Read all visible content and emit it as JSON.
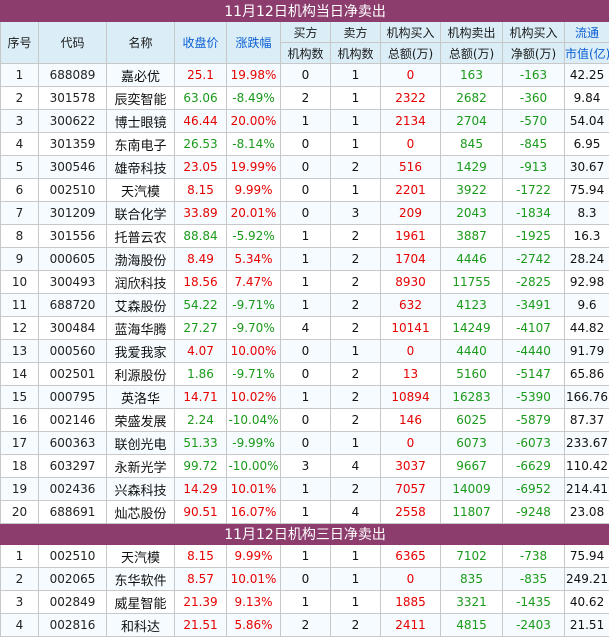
{
  "table1": {
    "title": "11月12日机构当日净卖出",
    "headers": {
      "idx": "序号",
      "code": "代码",
      "name": "名称",
      "close": "收盘价",
      "change": "涨跌幅",
      "buy_a": "买方",
      "buy_b": "机构数",
      "sell_a": "卖方",
      "sell_b": "机构数",
      "inst_buy_a": "机构买入",
      "inst_buy_b": "总额(万)",
      "inst_sell_a": "机构卖出",
      "inst_sell_b": "总额(万)",
      "net_a": "机构买入",
      "net_b": "净额(万)",
      "cap_a": "流通",
      "cap_b": "市值(亿)"
    },
    "rows": [
      {
        "idx": "1",
        "code": "688089",
        "name": "嘉必优",
        "close": "25.1",
        "change": "19.98%",
        "dir": "up",
        "buy": "0",
        "sell": "1",
        "ib": "0",
        "is": "163",
        "net": "-163",
        "cap": "42.25"
      },
      {
        "idx": "2",
        "code": "301578",
        "name": "辰奕智能",
        "close": "63.06",
        "change": "-8.49%",
        "dir": "down",
        "buy": "2",
        "sell": "1",
        "ib": "2322",
        "is": "2682",
        "net": "-360",
        "cap": "9.84"
      },
      {
        "idx": "3",
        "code": "300622",
        "name": "博士眼镜",
        "close": "46.44",
        "change": "20.00%",
        "dir": "up",
        "buy": "1",
        "sell": "1",
        "ib": "2134",
        "is": "2704",
        "net": "-570",
        "cap": "54.04"
      },
      {
        "idx": "4",
        "code": "301359",
        "name": "东南电子",
        "close": "26.53",
        "change": "-8.14%",
        "dir": "down",
        "buy": "0",
        "sell": "1",
        "ib": "0",
        "is": "845",
        "net": "-845",
        "cap": "6.95"
      },
      {
        "idx": "5",
        "code": "300546",
        "name": "雄帝科技",
        "close": "23.05",
        "change": "19.99%",
        "dir": "up",
        "buy": "0",
        "sell": "2",
        "ib": "516",
        "is": "1429",
        "net": "-913",
        "cap": "30.67"
      },
      {
        "idx": "6",
        "code": "002510",
        "name": "天汽模",
        "close": "8.15",
        "change": "9.99%",
        "dir": "up",
        "buy": "0",
        "sell": "1",
        "ib": "2201",
        "is": "3922",
        "net": "-1722",
        "cap": "75.94"
      },
      {
        "idx": "7",
        "code": "301209",
        "name": "联合化学",
        "close": "33.89",
        "change": "20.01%",
        "dir": "up",
        "buy": "0",
        "sell": "3",
        "ib": "209",
        "is": "2043",
        "net": "-1834",
        "cap": "8.3"
      },
      {
        "idx": "8",
        "code": "301556",
        "name": "托普云农",
        "close": "88.84",
        "change": "-5.92%",
        "dir": "down",
        "buy": "1",
        "sell": "2",
        "ib": "1961",
        "is": "3887",
        "net": "-1925",
        "cap": "16.3"
      },
      {
        "idx": "9",
        "code": "000605",
        "name": "渤海股份",
        "close": "8.49",
        "change": "5.34%",
        "dir": "up",
        "buy": "1",
        "sell": "2",
        "ib": "1704",
        "is": "4446",
        "net": "-2742",
        "cap": "28.24"
      },
      {
        "idx": "10",
        "code": "300493",
        "name": "润欣科技",
        "close": "18.56",
        "change": "7.47%",
        "dir": "up",
        "buy": "1",
        "sell": "2",
        "ib": "8930",
        "is": "11755",
        "net": "-2825",
        "cap": "92.98"
      },
      {
        "idx": "11",
        "code": "688720",
        "name": "艾森股份",
        "close": "54.22",
        "change": "-9.71%",
        "dir": "down",
        "buy": "1",
        "sell": "2",
        "ib": "632",
        "is": "4123",
        "net": "-3491",
        "cap": "9.6"
      },
      {
        "idx": "12",
        "code": "300484",
        "name": "蓝海华腾",
        "close": "27.27",
        "change": "-9.70%",
        "dir": "down",
        "buy": "4",
        "sell": "2",
        "ib": "10141",
        "is": "14249",
        "net": "-4107",
        "cap": "44.82"
      },
      {
        "idx": "13",
        "code": "000560",
        "name": "我爱我家",
        "close": "4.07",
        "change": "10.00%",
        "dir": "up",
        "buy": "0",
        "sell": "1",
        "ib": "0",
        "is": "4440",
        "net": "-4440",
        "cap": "91.79"
      },
      {
        "idx": "14",
        "code": "002501",
        "name": "利源股份",
        "close": "1.86",
        "change": "-9.71%",
        "dir": "down",
        "buy": "0",
        "sell": "2",
        "ib": "13",
        "is": "5160",
        "net": "-5147",
        "cap": "65.86"
      },
      {
        "idx": "15",
        "code": "000795",
        "name": "英洛华",
        "close": "14.71",
        "change": "10.02%",
        "dir": "up",
        "buy": "1",
        "sell": "2",
        "ib": "10894",
        "is": "16283",
        "net": "-5390",
        "cap": "166.76"
      },
      {
        "idx": "16",
        "code": "002146",
        "name": "荣盛发展",
        "close": "2.24",
        "change": "-10.04%",
        "dir": "down",
        "buy": "0",
        "sell": "2",
        "ib": "146",
        "is": "6025",
        "net": "-5879",
        "cap": "87.37"
      },
      {
        "idx": "17",
        "code": "600363",
        "name": "联创光电",
        "close": "51.33",
        "change": "-9.99%",
        "dir": "down",
        "buy": "0",
        "sell": "1",
        "ib": "0",
        "is": "6073",
        "net": "-6073",
        "cap": "233.67"
      },
      {
        "idx": "18",
        "code": "603297",
        "name": "永新光学",
        "close": "99.72",
        "change": "-10.00%",
        "dir": "down",
        "buy": "3",
        "sell": "4",
        "ib": "3037",
        "is": "9667",
        "net": "-6629",
        "cap": "110.42"
      },
      {
        "idx": "19",
        "code": "002436",
        "name": "兴森科技",
        "close": "14.29",
        "change": "10.01%",
        "dir": "up",
        "buy": "1",
        "sell": "2",
        "ib": "7057",
        "is": "14009",
        "net": "-6952",
        "cap": "214.41"
      },
      {
        "idx": "20",
        "code": "688691",
        "name": "灿芯股份",
        "close": "90.51",
        "change": "16.07%",
        "dir": "up",
        "buy": "1",
        "sell": "4",
        "ib": "2558",
        "is": "11807",
        "net": "-9248",
        "cap": "23.08"
      }
    ]
  },
  "table2": {
    "title": "11月12日机构三日净卖出",
    "rows": [
      {
        "idx": "1",
        "code": "002510",
        "name": "天汽模",
        "close": "8.15",
        "change": "9.99%",
        "dir": "up",
        "buy": "1",
        "sell": "1",
        "ib": "6365",
        "is": "7102",
        "net": "-738",
        "cap": "75.94"
      },
      {
        "idx": "2",
        "code": "002065",
        "name": "东华软件",
        "close": "8.57",
        "change": "10.01%",
        "dir": "up",
        "buy": "0",
        "sell": "1",
        "ib": "0",
        "is": "835",
        "net": "-835",
        "cap": "249.21"
      },
      {
        "idx": "3",
        "code": "002849",
        "name": "威星智能",
        "close": "21.39",
        "change": "9.13%",
        "dir": "up",
        "buy": "1",
        "sell": "1",
        "ib": "1885",
        "is": "3321",
        "net": "-1435",
        "cap": "40.62"
      },
      {
        "idx": "4",
        "code": "002816",
        "name": "和科达",
        "close": "21.51",
        "change": "5.86%",
        "dir": "up",
        "buy": "2",
        "sell": "2",
        "ib": "2411",
        "is": "4815",
        "net": "-2403",
        "cap": "21.51"
      }
    ]
  },
  "colors": {
    "title_bg": "#8c3d6e",
    "header_bg": "#dbeef7",
    "up": "#e60000",
    "down": "#1a9a1a"
  }
}
